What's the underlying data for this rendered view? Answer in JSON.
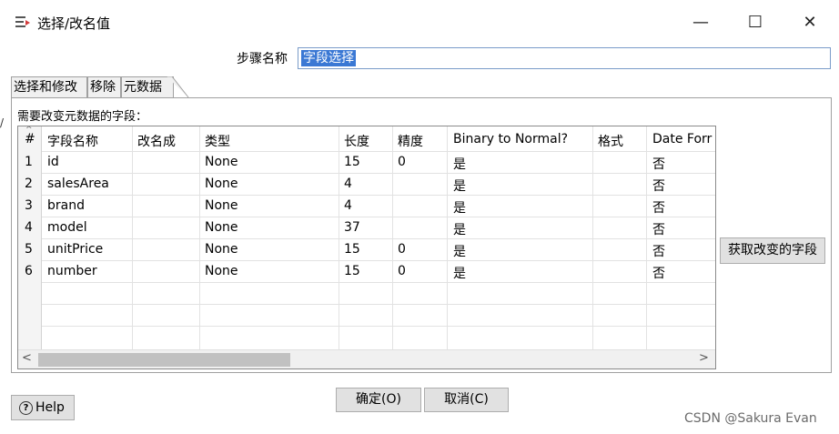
{
  "window": {
    "title": "选择/改名值",
    "minimize": "—",
    "maximize": "☐",
    "close": "✕"
  },
  "step": {
    "label": "步骤名称",
    "value": "字段选择"
  },
  "tabs": [
    {
      "label": "选择和修改",
      "active": false
    },
    {
      "label": "移除",
      "active": false
    },
    {
      "label": "元数据",
      "active": true
    }
  ],
  "fields_label": "需要改变元数据的字段：",
  "table": {
    "columns": [
      "#",
      "字段名称",
      "改名成",
      "类型",
      "长度",
      "精度",
      "Binary to Normal?",
      "格式",
      "Date Forr"
    ],
    "rows": [
      [
        "1",
        "id",
        "",
        "None",
        "15",
        "0",
        "是",
        "",
        "否"
      ],
      [
        "2",
        "salesArea",
        "",
        "None",
        "4",
        "",
        "是",
        "",
        "否"
      ],
      [
        "3",
        "brand",
        "",
        "None",
        "4",
        "",
        "是",
        "",
        "否"
      ],
      [
        "4",
        "model",
        "",
        "None",
        "37",
        "",
        "是",
        "",
        "否"
      ],
      [
        "5",
        "unitPrice",
        "",
        "None",
        "15",
        "0",
        "是",
        "",
        "否"
      ],
      [
        "6",
        "number",
        "",
        "None",
        "15",
        "0",
        "是",
        "",
        "否"
      ]
    ],
    "scroll_left": "<",
    "scroll_right": ">"
  },
  "buttons": {
    "get_fields": "获取改变的字段",
    "ok": "确定(O)",
    "cancel": "取消(C)",
    "help": "Help"
  },
  "watermark": "CSDN @Sakura Evan"
}
